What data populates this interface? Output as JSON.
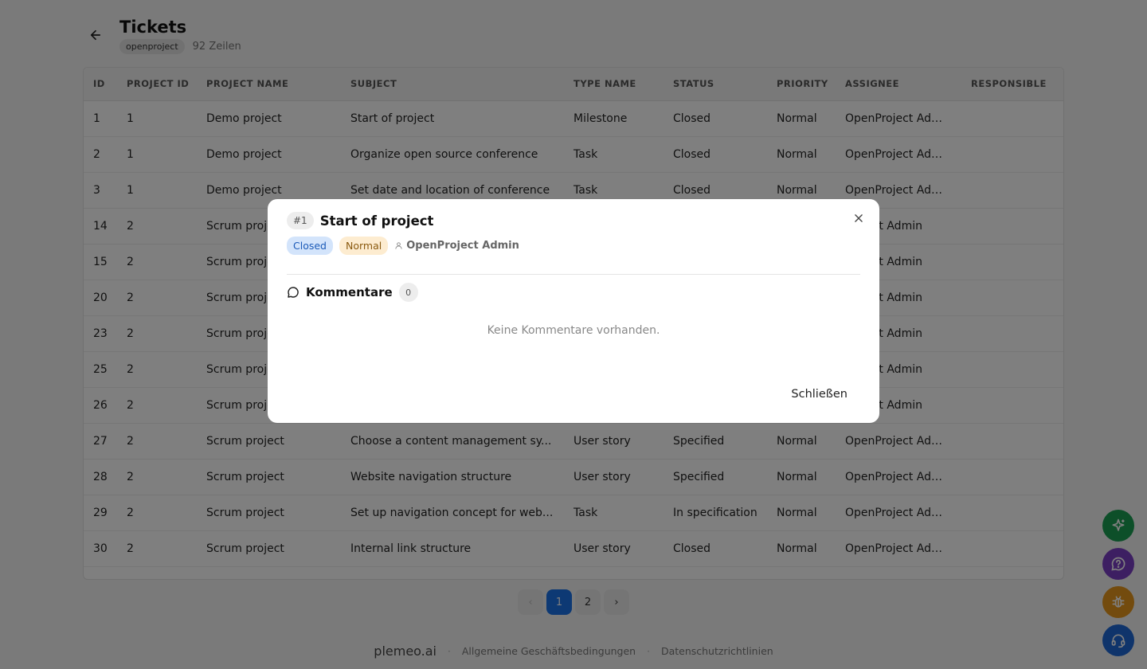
{
  "header": {
    "title": "Tickets",
    "tag": "openproject",
    "row_count": "92 Zeilen"
  },
  "table": {
    "columns": [
      "ID",
      "PROJECT ID",
      "PROJECT NAME",
      "SUBJECT",
      "TYPE NAME",
      "STATUS",
      "PRIORITY",
      "ASSIGNEE",
      "RESPONSIBLE"
    ],
    "rows": [
      [
        "1",
        "1",
        "Demo project",
        "Start of project",
        "Milestone",
        "Closed",
        "Normal",
        "OpenProject Admin",
        ""
      ],
      [
        "2",
        "1",
        "Demo project",
        "Organize open source conference",
        "Task",
        "Closed",
        "Normal",
        "OpenProject Admin",
        ""
      ],
      [
        "3",
        "1",
        "Demo project",
        "Set date and location of conference",
        "Task",
        "Closed",
        "Normal",
        "OpenProject Admin",
        ""
      ],
      [
        "14",
        "2",
        "Scrum proje",
        "",
        "",
        "",
        "",
        "Project Admin",
        ""
      ],
      [
        "15",
        "2",
        "Scrum proje",
        "",
        "",
        "",
        "",
        "Project Admin",
        ""
      ],
      [
        "20",
        "2",
        "Scrum proje",
        "",
        "",
        "",
        "",
        "Project Admin",
        ""
      ],
      [
        "23",
        "2",
        "Scrum proje",
        "",
        "",
        "",
        "",
        "Project Admin",
        ""
      ],
      [
        "25",
        "2",
        "Scrum proje",
        "",
        "",
        "",
        "",
        "Project Admin",
        ""
      ],
      [
        "26",
        "2",
        "Scrum proje",
        "",
        "",
        "",
        "",
        "Project Admin",
        ""
      ],
      [
        "27",
        "2",
        "Scrum project",
        "Choose a content management sy...",
        "User story",
        "Specified",
        "Normal",
        "OpenProject Admin",
        ""
      ],
      [
        "28",
        "2",
        "Scrum project",
        "Website navigation structure",
        "User story",
        "Specified",
        "Normal",
        "OpenProject Admin",
        ""
      ],
      [
        "29",
        "2",
        "Scrum project",
        "Set up navigation concept for web...",
        "Task",
        "In specification",
        "Normal",
        "OpenProject Admin",
        ""
      ],
      [
        "30",
        "2",
        "Scrum project",
        "Internal link structure",
        "User story",
        "Closed",
        "Normal",
        "OpenProject Admin",
        ""
      ]
    ]
  },
  "pagination": {
    "prev": "‹",
    "pages": [
      "1",
      "2"
    ],
    "next": "›",
    "current": "1"
  },
  "footer": {
    "brand": "plemeo.ai",
    "sep": "·",
    "terms": "Allgemeine Geschäftsbedingungen",
    "privacy": "Datenschutzrichtlinien"
  },
  "fabs": [
    {
      "icon": "sparkles-icon",
      "color": "#1a9e52"
    },
    {
      "icon": "help-chat-icon",
      "color": "#7b3fc4"
    },
    {
      "icon": "bug-icon",
      "color": "#e6961c"
    },
    {
      "icon": "headset-icon",
      "color": "#1f68d6"
    }
  ],
  "modal": {
    "ticket_id": "#1",
    "title": "Start of project",
    "status": "Closed",
    "priority": "Normal",
    "assignee": "OpenProject Admin",
    "comments_label": "Kommentare",
    "comments_count": "0",
    "empty_text": "Keine Kommentare vorhanden.",
    "close_label": "Schließen"
  },
  "colors": {
    "accent": "#1a73e8",
    "status_bg": "#d3e4fb",
    "priority_bg": "#fdecd0"
  }
}
